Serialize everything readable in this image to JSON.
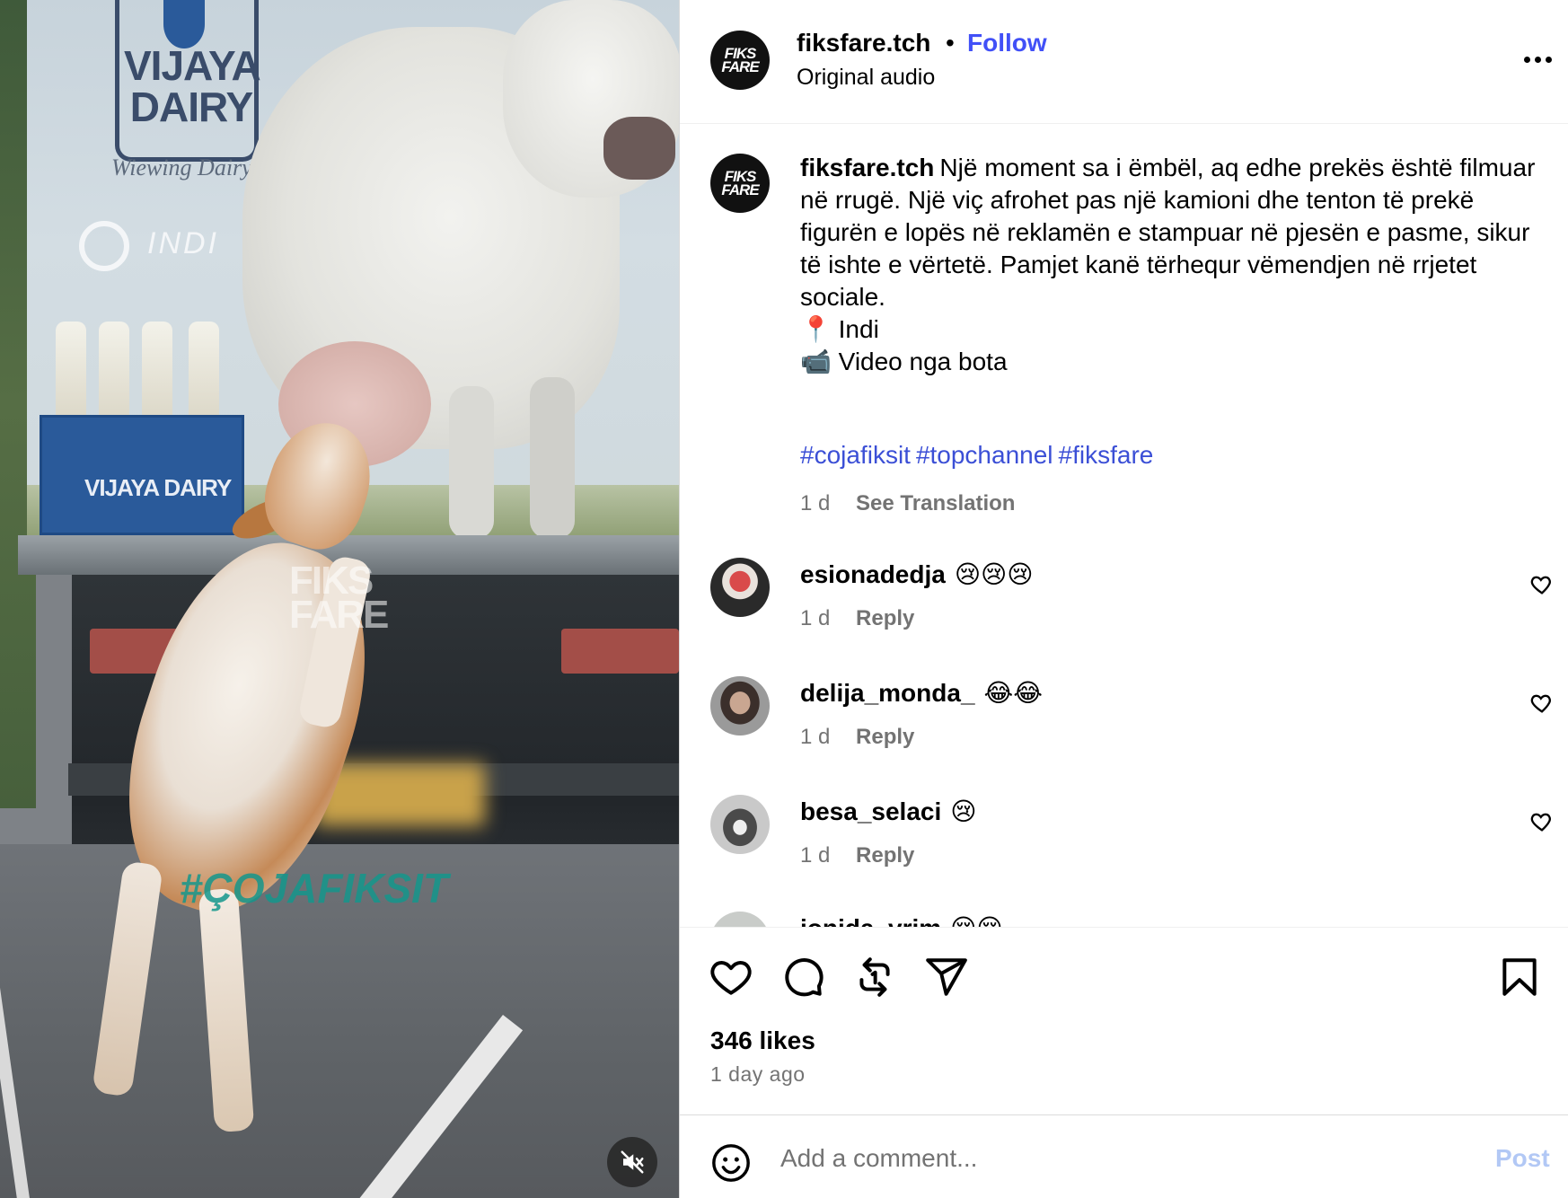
{
  "media": {
    "brand_logo": "VIJAYA DAIRY",
    "brand_logo_line1": "VIJAYA",
    "brand_logo_line2": "DAIRY",
    "brand_tagline": "Wiewing Dairy",
    "indi_label": "INDI",
    "crate_label": "VIJAYA DAIRY",
    "watermark_line1": "FIKS",
    "watermark_line2": "FARE",
    "watermark_hashtag": "#ÇOJAFIKSIT",
    "mute_icon": "speaker-muted-icon"
  },
  "header": {
    "avatar_line1": "FIKS",
    "avatar_line2": "FARE",
    "username": "fiksfare.tch",
    "separator": "•",
    "follow_label": "Follow",
    "audio_label": "Original audio",
    "more_icon": "more-options-icon"
  },
  "caption": {
    "username": "fiksfare.tch",
    "text": "Një moment sa i ëmbël, aq edhe prekës është filmuar në rrugë. Një viç afrohet pas një kamioni dhe tenton të prekë figurën e lopës në reklamën e stampuar në pjesën e pasme, sikur të ishte e vërtetë. Pamjet kanë tërhequr vëmendjen në rrjetet sociale.",
    "location_line": "📍 Indi",
    "video_line": "📹 Video nga bota",
    "hashtags": [
      "#cojafiksit",
      "#topchannel",
      "#fiksfare"
    ],
    "time": "1 d",
    "translate_label": "See Translation"
  },
  "comments": [
    {
      "username": "esionadedja",
      "text": "😢😢😢",
      "time": "1 d",
      "reply_label": "Reply"
    },
    {
      "username": "delija_monda_",
      "text": "😂😂",
      "time": "1 d",
      "reply_label": "Reply"
    },
    {
      "username": "besa_selaci",
      "text": "😢",
      "time": "1 d",
      "reply_label": "Reply"
    },
    {
      "username": "ionida_vrim",
      "text": "😢😢",
      "time": "",
      "reply_label": ""
    }
  ],
  "actions": {
    "icons": [
      "heart-icon",
      "comment-icon",
      "repost-icon",
      "share-icon",
      "bookmark-icon"
    ],
    "likes": "346 likes",
    "posted": "1 day ago"
  },
  "composer": {
    "emoji_icon": "emoji-icon",
    "placeholder": "Add a comment...",
    "post_label": "Post"
  },
  "colors": {
    "link_blue": "#4150f7",
    "hashtag_blue": "#3b4fd6",
    "muted_text": "#737373",
    "post_disabled": "#b2c8f5"
  }
}
